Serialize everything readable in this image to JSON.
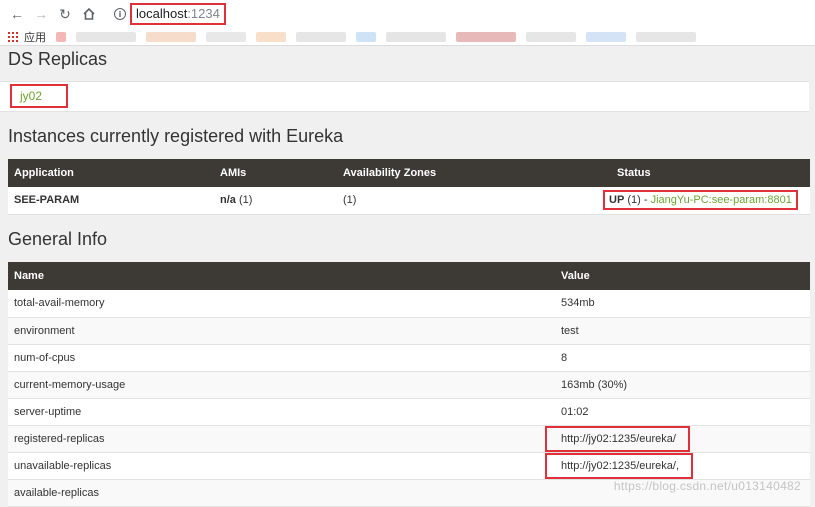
{
  "browser": {
    "url_host": "localhost",
    "url_port": ":1234",
    "bookmarks_apps_label": "应用"
  },
  "ds_replicas": {
    "title": "DS Replicas",
    "replica": "jy02"
  },
  "instances": {
    "title": "Instances currently registered with Eureka",
    "headers": [
      "Application",
      "AMIs",
      "Availability Zones",
      "Status"
    ],
    "rows": [
      {
        "application": "SEE-PARAM",
        "amis_bold": "n/a",
        "amis_count": "(1)",
        "zones": "(1)",
        "status_bold": "UP",
        "status_count": "(1) -",
        "status_link": "JiangYu-PC:see-param:8801"
      }
    ]
  },
  "general": {
    "title": "General Info",
    "headers": [
      "Name",
      "Value"
    ],
    "rows": [
      {
        "name": "total-avail-memory",
        "value": "534mb"
      },
      {
        "name": "environment",
        "value": "test"
      },
      {
        "name": "num-of-cpus",
        "value": "8"
      },
      {
        "name": "current-memory-usage",
        "value": "163mb (30%)"
      },
      {
        "name": "server-uptime",
        "value": "01:02"
      },
      {
        "name": "registered-replicas",
        "value": "http://jy02:1235/eureka/"
      },
      {
        "name": "unavailable-replicas",
        "value": "http://jy02:1235/eureka/,"
      },
      {
        "name": "available-replicas",
        "value": ""
      }
    ]
  },
  "watermark": "https://blog.csdn.net/u013140482",
  "colors": {
    "header_bg": "#3d3a35",
    "link_green": "#6da434",
    "highlight_red": "#e0313a"
  }
}
